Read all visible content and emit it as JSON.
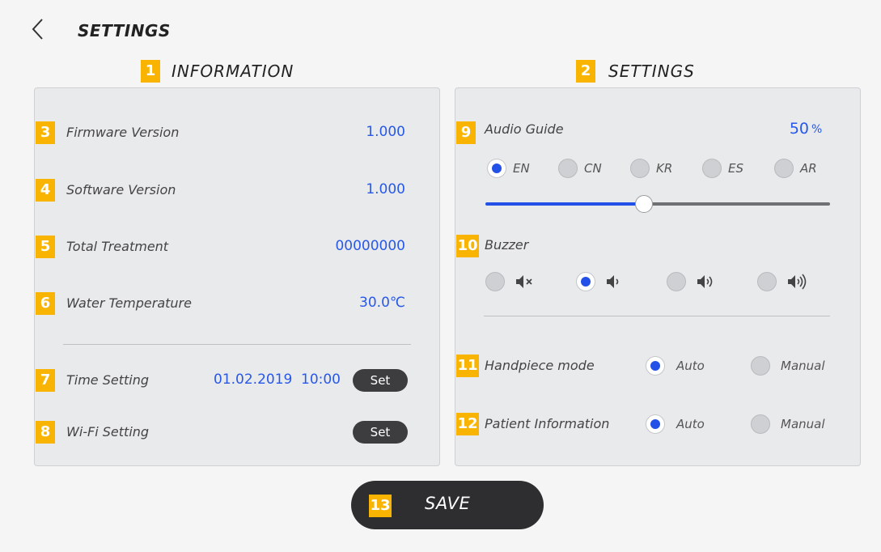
{
  "header": {
    "title": "SETTINGS"
  },
  "information": {
    "badge": "1",
    "title": "INFORMATION",
    "rows": [
      {
        "badge": "3",
        "label": "Firmware Version",
        "value": "1.000"
      },
      {
        "badge": "4",
        "label": "Software Version",
        "value": "1.000"
      },
      {
        "badge": "5",
        "label": "Total Treatment",
        "value": "00000000"
      },
      {
        "badge": "6",
        "label": "Water Temperature",
        "value": "30.0℃"
      }
    ],
    "time": {
      "badge": "7",
      "label": "Time Setting",
      "date": "01.02.2019",
      "time": "10:00",
      "button": "Set"
    },
    "wifi": {
      "badge": "8",
      "label": "Wi-Fi Setting",
      "button": "Set"
    }
  },
  "settings": {
    "badge": "2",
    "title": "SETTINGS",
    "audio": {
      "badge": "9",
      "label": "Audio Guide",
      "volume_value": "50",
      "volume_unit": "%",
      "volume_level": 0.46,
      "languages": [
        {
          "code": "EN",
          "selected": true
        },
        {
          "code": "CN",
          "selected": false
        },
        {
          "code": "KR",
          "selected": false
        },
        {
          "code": "ES",
          "selected": false
        },
        {
          "code": "AR",
          "selected": false
        }
      ]
    },
    "buzzer": {
      "badge": "10",
      "label": "Buzzer",
      "options": [
        {
          "icon": "speaker-mute-icon",
          "selected": false
        },
        {
          "icon": "speaker-low-icon",
          "selected": true
        },
        {
          "icon": "speaker-medium-icon",
          "selected": false
        },
        {
          "icon": "speaker-high-icon",
          "selected": false
        }
      ]
    },
    "handpiece": {
      "badge": "11",
      "label": "Handpiece mode",
      "auto": "Auto",
      "manual": "Manual",
      "selected": "Auto"
    },
    "patient": {
      "badge": "12",
      "label": "Patient Information",
      "auto": "Auto",
      "manual": "Manual",
      "selected": "Auto"
    }
  },
  "save": {
    "badge": "13",
    "label": "SAVE"
  },
  "colors": {
    "accent": "#2350e6",
    "badge": "#f8b400",
    "value_text": "#2758e8",
    "dark_button": "#3d3d3f"
  }
}
